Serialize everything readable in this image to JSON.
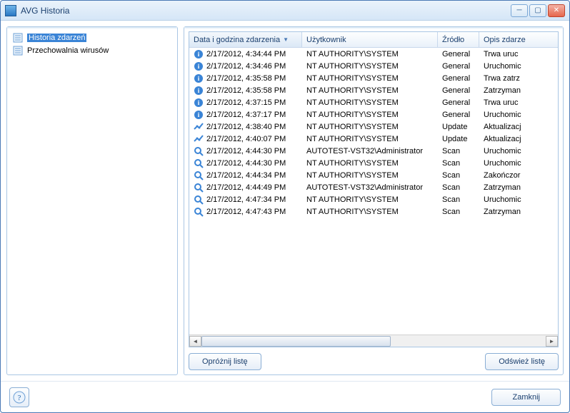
{
  "window": {
    "title": "AVG Historia"
  },
  "titlebar_buttons": {
    "minimize_glyph": "─",
    "maximize_glyph": "▢",
    "close_glyph": "✕"
  },
  "sidebar": {
    "items": [
      {
        "label": "Historia zdarzeń",
        "selected": true
      },
      {
        "label": "Przechowalnia wirusów",
        "selected": false
      }
    ]
  },
  "table": {
    "columns": {
      "date": "Data i godzina zdarzenia",
      "user": "Użytkownik",
      "source": "Źródło",
      "desc": "Opis zdarze"
    },
    "sorted_column": "date",
    "rows": [
      {
        "icon": "info",
        "date": "2/17/2012, 4:34:44 PM",
        "user": "NT AUTHORITY\\SYSTEM",
        "source": "General",
        "desc": "Trwa uruc"
      },
      {
        "icon": "info",
        "date": "2/17/2012, 4:34:46 PM",
        "user": "NT AUTHORITY\\SYSTEM",
        "source": "General",
        "desc": "Uruchomic"
      },
      {
        "icon": "info",
        "date": "2/17/2012, 4:35:58 PM",
        "user": "NT AUTHORITY\\SYSTEM",
        "source": "General",
        "desc": "Trwa zatrz"
      },
      {
        "icon": "info",
        "date": "2/17/2012, 4:35:58 PM",
        "user": "NT AUTHORITY\\SYSTEM",
        "source": "General",
        "desc": "Zatrzyman"
      },
      {
        "icon": "info",
        "date": "2/17/2012, 4:37:15 PM",
        "user": "NT AUTHORITY\\SYSTEM",
        "source": "General",
        "desc": "Trwa uruc"
      },
      {
        "icon": "info",
        "date": "2/17/2012, 4:37:17 PM",
        "user": "NT AUTHORITY\\SYSTEM",
        "source": "General",
        "desc": "Uruchomic"
      },
      {
        "icon": "update",
        "date": "2/17/2012, 4:38:40 PM",
        "user": "NT AUTHORITY\\SYSTEM",
        "source": "Update",
        "desc": "Aktualizacj"
      },
      {
        "icon": "update",
        "date": "2/17/2012, 4:40:07 PM",
        "user": "NT AUTHORITY\\SYSTEM",
        "source": "Update",
        "desc": "Aktualizacj"
      },
      {
        "icon": "scan",
        "date": "2/17/2012, 4:44:30 PM",
        "user": "AUTOTEST-VST32\\Administrator",
        "source": "Scan",
        "desc": "Uruchomic"
      },
      {
        "icon": "scan",
        "date": "2/17/2012, 4:44:30 PM",
        "user": "NT AUTHORITY\\SYSTEM",
        "source": "Scan",
        "desc": "Uruchomic"
      },
      {
        "icon": "scan",
        "date": "2/17/2012, 4:44:34 PM",
        "user": "NT AUTHORITY\\SYSTEM",
        "source": "Scan",
        "desc": "Zakończor"
      },
      {
        "icon": "scan",
        "date": "2/17/2012, 4:44:49 PM",
        "user": "AUTOTEST-VST32\\Administrator",
        "source": "Scan",
        "desc": "Zatrzyman"
      },
      {
        "icon": "scan",
        "date": "2/17/2012, 4:47:34 PM",
        "user": "NT AUTHORITY\\SYSTEM",
        "source": "Scan",
        "desc": "Uruchomic"
      },
      {
        "icon": "scan",
        "date": "2/17/2012, 4:47:43 PM",
        "user": "NT AUTHORITY\\SYSTEM",
        "source": "Scan",
        "desc": "Zatrzyman"
      }
    ]
  },
  "buttons": {
    "empty_list": "Opróżnij listę",
    "refresh_list": "Odśwież listę",
    "close": "Zamknij"
  },
  "help_glyph": "?"
}
